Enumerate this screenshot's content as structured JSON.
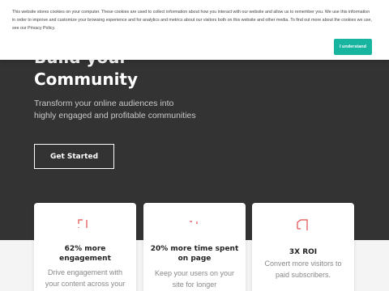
{
  "hero": {
    "title_line1": "Build your",
    "title_line2": "Community",
    "subtitle": "Transform your online audiences into highly engaged and profitable communities",
    "cta_label": "Get Started"
  },
  "cards": [
    {
      "title": "62% more engagement",
      "desc": "Drive engagement with your content across your",
      "icon": "engagement-icon"
    },
    {
      "title": "20% more time spent on page",
      "desc": "Keep your users on your site for longer",
      "icon": "time-icon"
    },
    {
      "title": "3X ROI",
      "desc": "Convert more visitors to paid subscribers.",
      "icon": "roi-icon"
    }
  ],
  "cookie_banner": {
    "text": "This website stores cookies on your computer. These cookies are used to collect information about how you interact with our website and allow us to remember you. We use this information in order to improve and customize your browsing experience and for analytics and metrics about our visitors both on this website and other media. To find out more about the cookies we use, see our Privacy Policy.",
    "button_label": "I understand"
  },
  "colors": {
    "hero_bg": "#333333",
    "accent": "#17b59f",
    "icon_red": "#e34b4b"
  }
}
